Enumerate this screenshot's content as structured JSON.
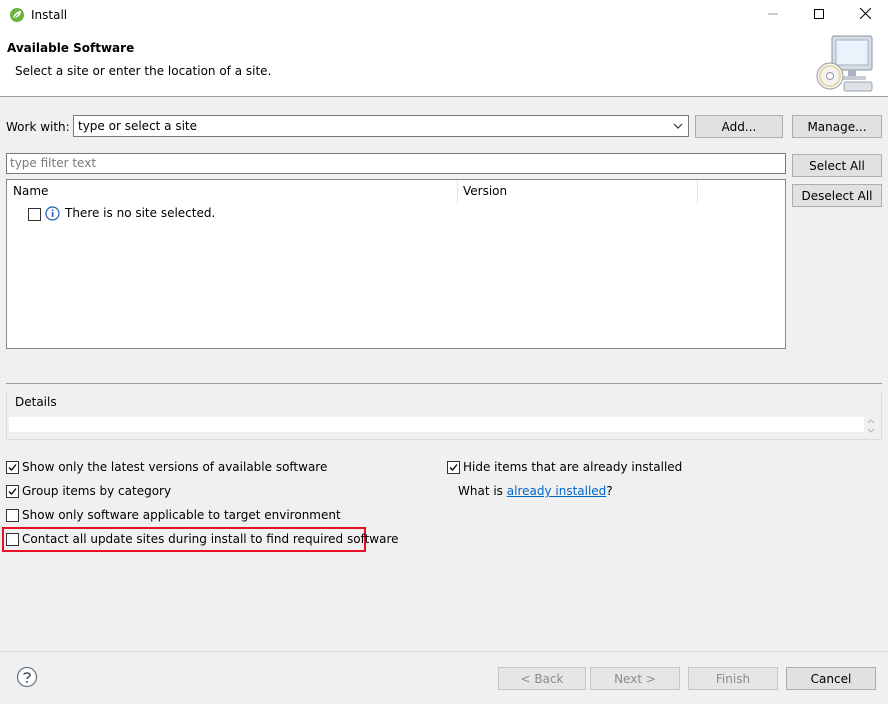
{
  "window": {
    "title": "Install",
    "app_icon": "spring-leaf-icon",
    "controls": [
      "minimize-icon",
      "maximize-icon",
      "close-icon"
    ]
  },
  "banner": {
    "title": "Available Software",
    "subtitle": "Select a site or enter the location of a site.",
    "image": "install-cd-monitor-icon"
  },
  "work_with": {
    "label": "Work with:",
    "value": "type or select a site",
    "add_label": "Add...",
    "manage_label": "Manage..."
  },
  "filter": {
    "placeholder": "type filter text",
    "select_all_label": "Select All",
    "deselect_all_label": "Deselect All"
  },
  "table": {
    "columns": [
      "Name",
      "Version"
    ],
    "rows": [
      {
        "checked": false,
        "icon": "info-icon",
        "text": "There is no site selected."
      }
    ]
  },
  "details": {
    "label": "Details",
    "value": ""
  },
  "options": {
    "show_latest": {
      "label": "Show only the latest versions of available software",
      "checked": true
    },
    "group_by_category": {
      "label": "Group items by category",
      "checked": true
    },
    "show_applicable": {
      "label": "Show only software applicable to target environment",
      "checked": false
    },
    "contact_all": {
      "label": "Contact all update sites during install to find required software",
      "checked": false
    },
    "hide_installed": {
      "label": "Hide items that are already installed",
      "checked": true
    },
    "what_is_prefix": "What is ",
    "what_is_link": "already installed",
    "what_is_suffix": "?"
  },
  "footer": {
    "help_icon": "help-icon",
    "back_label": "< Back",
    "next_label": "Next >",
    "finish_label": "Finish",
    "cancel_label": "Cancel"
  },
  "colors": {
    "highlight": "#e81123",
    "link": "#0066cc",
    "dialog_bg": "#f0f0f0"
  }
}
